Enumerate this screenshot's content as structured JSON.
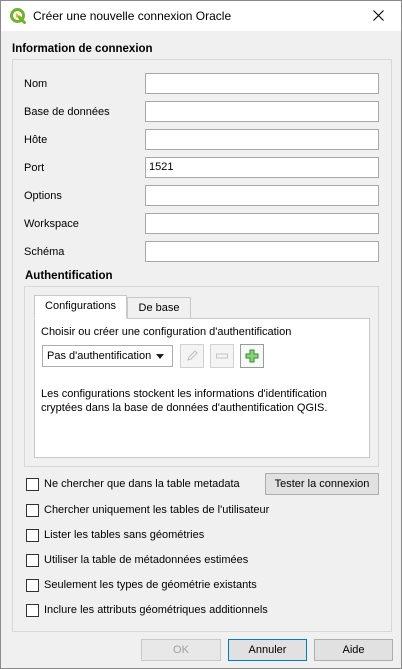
{
  "window": {
    "title": "Créer une nouvelle connexion Oracle",
    "colors": {
      "qgis_green": "#6fb42c",
      "accent_border": "#0078d7",
      "add_icon_green": "#2f8f2f"
    }
  },
  "connection_group": {
    "title": "Information de connexion",
    "fields": [
      {
        "label": "Nom",
        "value": ""
      },
      {
        "label": "Base de données",
        "value": ""
      },
      {
        "label": "Hôte",
        "value": ""
      },
      {
        "label": "Port",
        "value": "1521"
      },
      {
        "label": "Options",
        "value": ""
      },
      {
        "label": "Workspace",
        "value": ""
      },
      {
        "label": "Schéma",
        "value": ""
      }
    ]
  },
  "auth": {
    "title": "Authentification",
    "tabs": [
      "Configurations",
      "De base"
    ],
    "active_tab": "Configurations",
    "choose_label": "Choisir ou créer une configuration d'authentification",
    "combo_value": "Pas d'authentification",
    "icons": [
      "edit-icon",
      "remove-icon",
      "add-icon"
    ],
    "info_line1": "Les configurations stockent les informations d'identification",
    "info_line2": "cryptées dans la base de données d'authentification QGIS."
  },
  "options": [
    {
      "label": "Ne chercher que dans la table metadata",
      "checked": false
    },
    {
      "label": "Chercher uniquement les tables de l'utilisateur",
      "checked": false
    },
    {
      "label": "Lister les tables sans géométries",
      "checked": false
    },
    {
      "label": "Utiliser la table de métadonnées estimées",
      "checked": false
    },
    {
      "label": "Seulement les types de géométrie existants",
      "checked": false
    },
    {
      "label": "Inclure les attributs géométriques additionnels",
      "checked": false
    }
  ],
  "buttons": {
    "test": "Tester la connexion",
    "ok": "OK",
    "cancel": "Annuler",
    "help": "Aide"
  }
}
